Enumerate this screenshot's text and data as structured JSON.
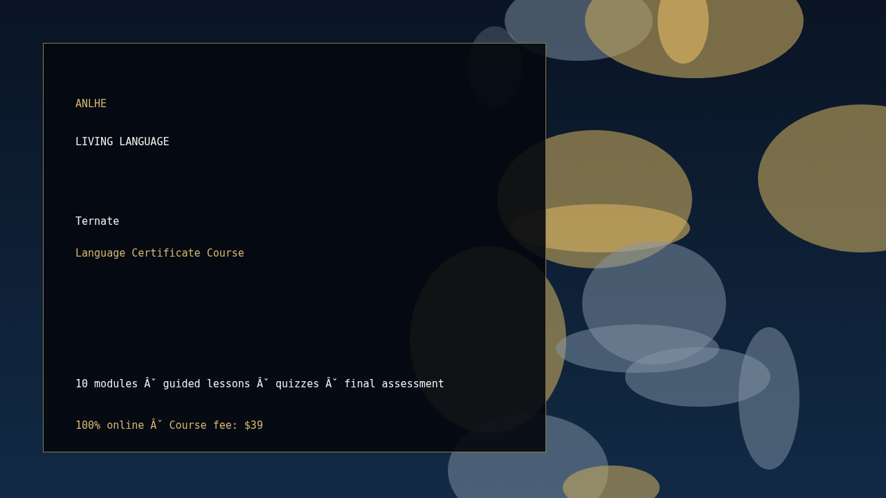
{
  "card": {
    "brand": "ANLHE",
    "tagline": "LIVING LANGUAGE",
    "title": "Ternate",
    "subtitle": "Language Certificate Course",
    "details": "10 modules Âˇ guided lessons Âˇ quizzes Âˇ final assessment",
    "price": "100% online Âˇ Course fee: $39"
  }
}
